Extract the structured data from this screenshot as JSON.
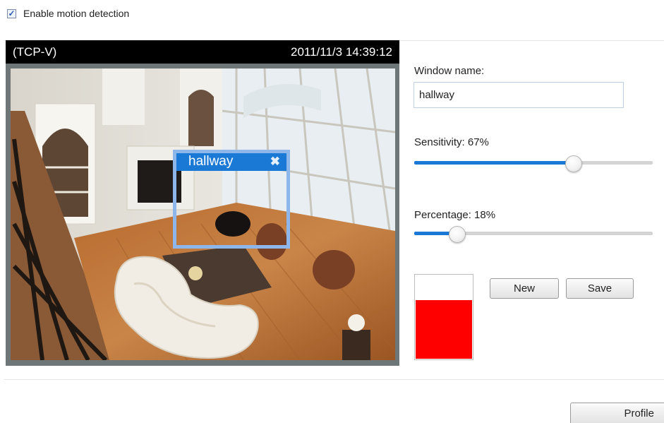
{
  "motion_detection": {
    "enable_label": "Enable motion detection",
    "enabled": true
  },
  "camera": {
    "stream_label": "(TCP-V)",
    "timestamp": "2011/11/3 14:39:12",
    "motion_window": {
      "name": "hallway",
      "close_glyph": "✖"
    }
  },
  "settings": {
    "window_name_label": "Window name:",
    "window_name_value": "hallway",
    "sensitivity_label": "Sensitivity: 67%",
    "sensitivity_value": 67,
    "percentage_label": "Percentage: 18%",
    "percentage_value": 18,
    "activity_level": 0.7,
    "activity_color": "#ff0000"
  },
  "buttons": {
    "new_label": "New",
    "save_label": "Save",
    "profile_label": "Profile"
  },
  "colors": {
    "accent": "#1b79d6",
    "camera_border": "#6f7677",
    "window_border": "#8db7ea"
  },
  "icons": [
    "checkbox-check-icon",
    "close-icon"
  ]
}
